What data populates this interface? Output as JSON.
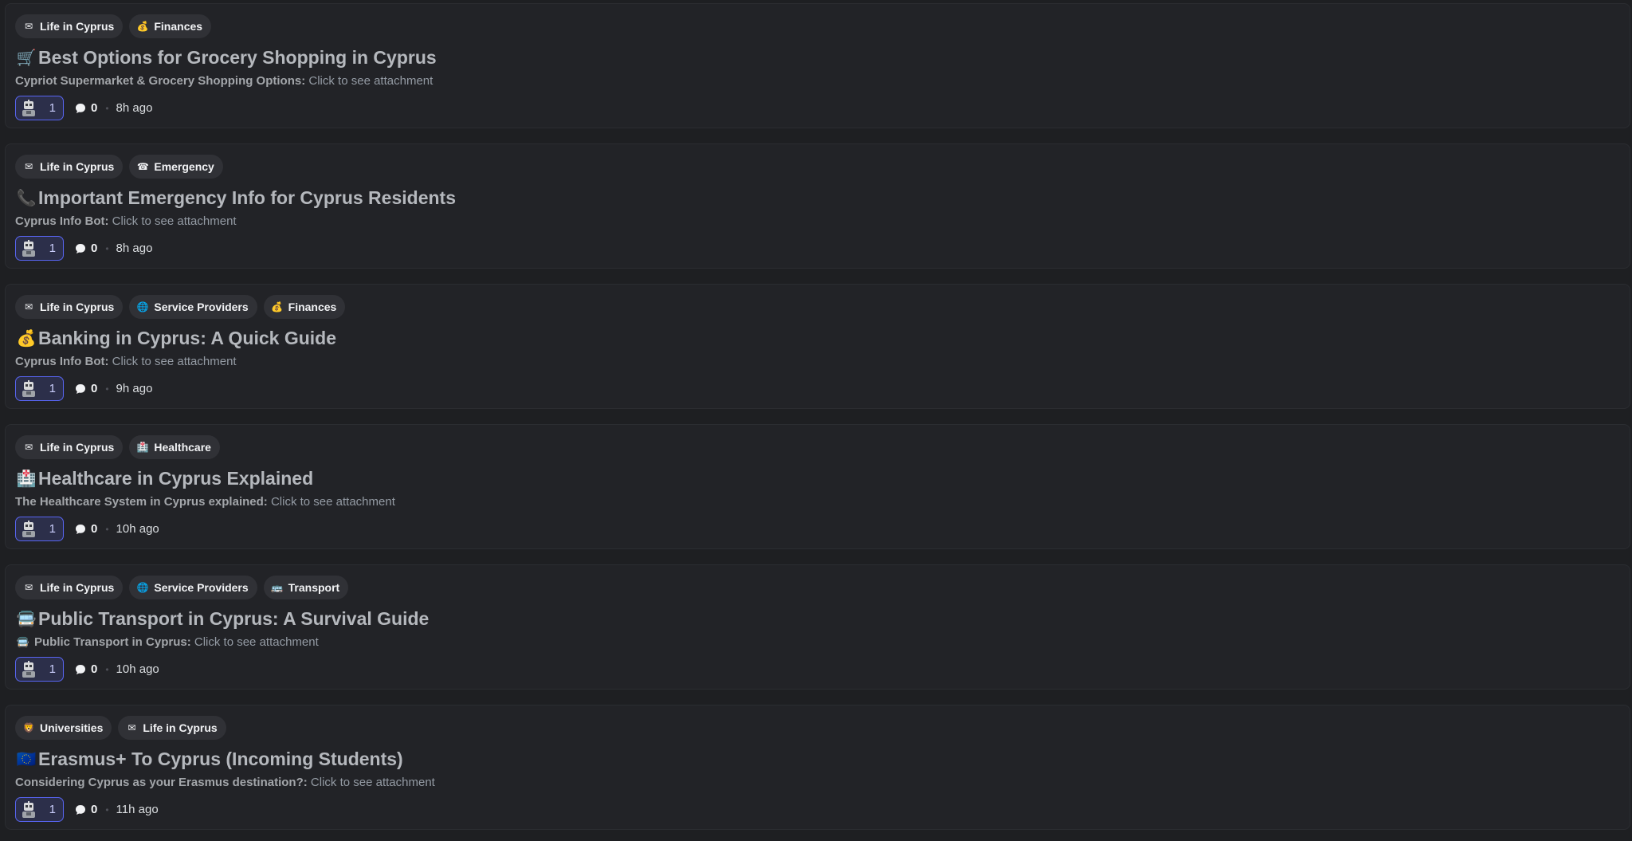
{
  "posts": [
    {
      "tags": [
        {
          "emoji": "✉",
          "label": "Life in Cyprus"
        },
        {
          "emoji": "💰",
          "label": "Finances"
        }
      ],
      "title_emoji": "🛒",
      "title": "Best Options for Grocery Shopping in Cyprus",
      "preview_emoji": "",
      "preview_author": "Cypriot Supermarket & Grocery Shopping Options",
      "preview_text": "Click to see attachment",
      "reaction_count": "1",
      "comment_count": "0",
      "time": "8h ago"
    },
    {
      "tags": [
        {
          "emoji": "✉",
          "label": "Life in Cyprus"
        },
        {
          "emoji": "☎",
          "label": "Emergency"
        }
      ],
      "title_emoji": "📞",
      "title": "Important Emergency Info for Cyprus Residents",
      "preview_emoji": "",
      "preview_author": "Cyprus Info Bot",
      "preview_text": "Click to see attachment",
      "reaction_count": "1",
      "comment_count": "0",
      "time": "8h ago"
    },
    {
      "tags": [
        {
          "emoji": "✉",
          "label": "Life in Cyprus"
        },
        {
          "emoji": "🌐",
          "label": "Service Providers"
        },
        {
          "emoji": "💰",
          "label": "Finances"
        }
      ],
      "title_emoji": "💰",
      "title": "Banking in Cyprus: A Quick Guide",
      "preview_emoji": "",
      "preview_author": "Cyprus Info Bot",
      "preview_text": "Click to see attachment",
      "reaction_count": "1",
      "comment_count": "0",
      "time": "9h ago"
    },
    {
      "tags": [
        {
          "emoji": "✉",
          "label": "Life in Cyprus"
        },
        {
          "emoji": "🏥",
          "label": "Healthcare"
        }
      ],
      "title_emoji": "🏥",
      "title": "Healthcare in Cyprus Explained",
      "preview_emoji": "",
      "preview_author": "The Healthcare System in Cyprus explained",
      "preview_text": "Click to see attachment",
      "reaction_count": "1",
      "comment_count": "0",
      "time": "10h ago"
    },
    {
      "tags": [
        {
          "emoji": "✉",
          "label": "Life in Cyprus"
        },
        {
          "emoji": "🌐",
          "label": "Service Providers"
        },
        {
          "emoji": "🚌",
          "label": "Transport"
        }
      ],
      "title_emoji": "🚍",
      "title": "Public Transport in Cyprus: A Survival Guide",
      "preview_emoji": "🚍",
      "preview_author": "Public Transport in Cyprus",
      "preview_text": "Click to see attachment",
      "reaction_count": "1",
      "comment_count": "0",
      "time": "10h ago"
    },
    {
      "tags": [
        {
          "emoji": "🦁",
          "label": "Universities"
        },
        {
          "emoji": "✉",
          "label": "Life in Cyprus"
        }
      ],
      "title_emoji": "🇪🇺",
      "title": "Erasmus+ To Cyprus (Incoming Students)",
      "preview_emoji": "",
      "preview_author": "Considering Cyprus as your Erasmus destination?",
      "preview_text": "Click to see attachment",
      "reaction_count": "1",
      "comment_count": "0",
      "time": "11h ago"
    }
  ]
}
